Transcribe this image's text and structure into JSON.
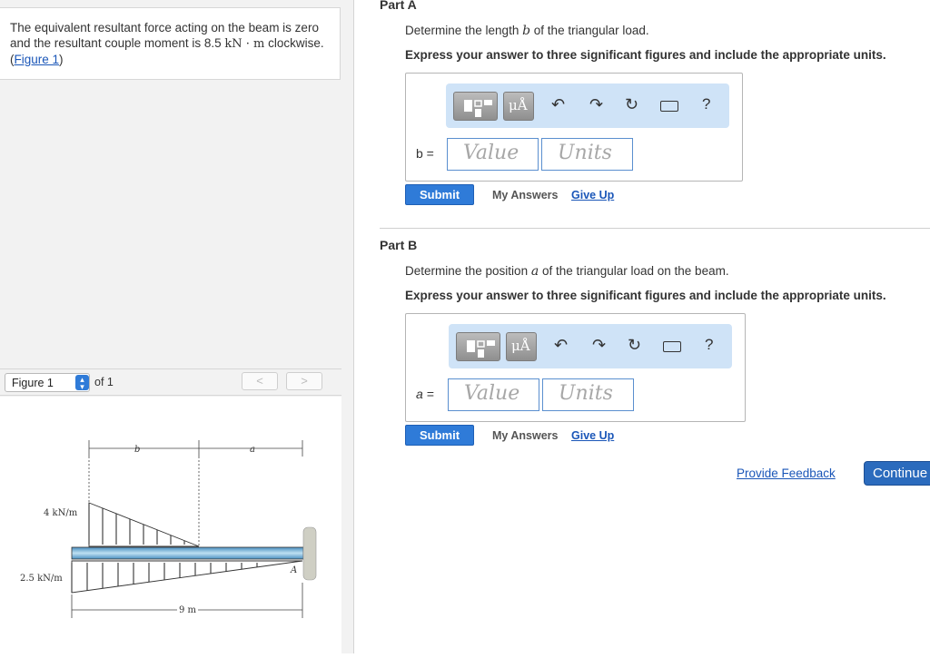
{
  "problem": {
    "text_before": "The equivalent resultant force acting on the beam is zero and the resultant couple moment is 8.5 ",
    "unit": "kN · m",
    "text_after": " clockwise. (",
    "figure_link": "Figure 1",
    "text_close": ")"
  },
  "figure_nav": {
    "selected": "Figure 1",
    "of_label": "of 1",
    "prev_glyph": "<",
    "next_glyph": ">"
  },
  "figure": {
    "label_b": "b",
    "label_a": "a",
    "label_A": "A",
    "load_top": "4 kN/m",
    "load_bottom": "2.5 kN/m",
    "span": "9 m"
  },
  "toolbar": {
    "units_glyph": "μÅ",
    "help": "?"
  },
  "part_a": {
    "title": "Part A",
    "instruction_pre": "Determine the length ",
    "instruction_var": "b",
    "instruction_post": " of the triangular load.",
    "express": "Express your answer to three significant figures and include the appropriate units.",
    "var_label": "b =",
    "value_placeholder": "Value",
    "units_placeholder": "Units",
    "submit": "Submit",
    "my_answers": "My Answers",
    "give_up": "Give Up"
  },
  "part_b": {
    "title": "Part B",
    "instruction_pre": "Determine the position ",
    "instruction_var": "a",
    "instruction_post": " of the triangular load on the beam.",
    "express": "Express your answer to three significant figures and include the appropriate units.",
    "var_label": "a =",
    "value_placeholder": "Value",
    "units_placeholder": "Units",
    "submit": "Submit",
    "my_answers": "My Answers",
    "give_up": "Give Up"
  },
  "footer": {
    "feedback": "Provide Feedback",
    "continue": "Continue"
  }
}
